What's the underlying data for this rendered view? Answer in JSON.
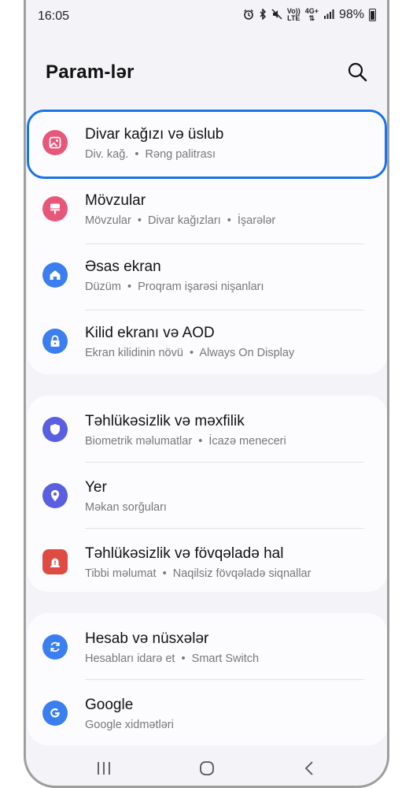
{
  "status_bar": {
    "time": "16:05",
    "volte_top": "Vo))",
    "volte_bottom": "LTE",
    "network_top": "4G+",
    "battery_percent": "98%"
  },
  "header": {
    "title": "Param-lər",
    "search_icon": "search-icon"
  },
  "colors": {
    "pink": "#e8567a",
    "blue": "#3a7ef0",
    "purple": "#5a5ee0",
    "red": "#e04b41",
    "highlight": "#1a73e8"
  },
  "groups": [
    {
      "items": [
        {
          "label": "Divar kağızı və üslub",
          "sub1": "Div. kağ.",
          "sub2": "Rəng palitrası",
          "icon": "wallpaper-icon",
          "highlighted": true
        },
        {
          "label": "Mövzular",
          "sub1": "Mövzular",
          "sub2": "Divar kağızları",
          "sub3": "İşarələr",
          "icon": "themes-icon"
        },
        {
          "label": "Əsas ekran",
          "sub1": "Düzüm",
          "sub2": "Proqram işarəsi nişanları",
          "icon": "home-icon"
        },
        {
          "label": "Kilid ekranı və AOD",
          "sub1": "Ekran kilidinin növü",
          "sub2": "Always On Display",
          "icon": "lock-icon"
        }
      ]
    },
    {
      "items": [
        {
          "label": "Təhlükəsizlik və məxfilik",
          "sub1": "Biometrik məlumatlar",
          "sub2": "İcazə meneceri",
          "icon": "shield-icon"
        },
        {
          "label": "Yer",
          "sub1": "Məkan sorğuları",
          "icon": "location-pin-icon"
        },
        {
          "label": "Təhlükəsizlik və fövqəladə hal",
          "sub1": "Tibbi məlumat",
          "sub2": "Naqilsiz fövqəladə siqnallar",
          "icon": "emergency-icon"
        }
      ]
    },
    {
      "items": [
        {
          "label": "Hesab və nüsxələr",
          "sub1": "Hesabları idarə et",
          "sub2": "Smart Switch",
          "icon": "sync-icon"
        },
        {
          "label": "Google",
          "sub1": "Google xidmətləri",
          "icon": "google-icon"
        }
      ]
    }
  ],
  "nav_bar": {
    "recents": "recents-icon",
    "home": "home-nav-icon",
    "back": "back-icon"
  }
}
